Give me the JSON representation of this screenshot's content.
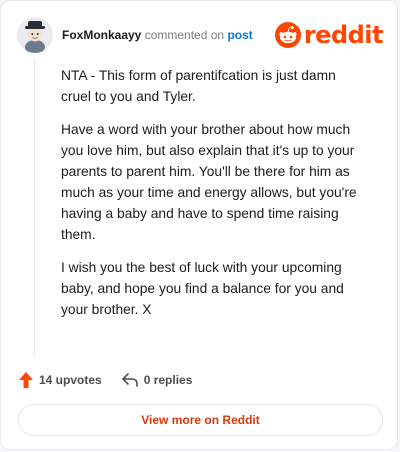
{
  "header": {
    "username": "FoxMonkaayy",
    "action_text": "commented on",
    "target_link": "post",
    "logo_text": "reddit"
  },
  "comment": {
    "paragraphs": [
      "NTA - This form of parentifcation is just damn cruel to you and Tyler.",
      "Have a word with your brother about how much you love him, but also explain that it's up to your parents to parent him. You'll be there for him as much as your time and energy allows, but you're having a baby and have to spend time raising them.",
      "I wish you the best of luck with your upcoming baby, and hope you find a balance for you and your brother. X"
    ]
  },
  "actions": {
    "upvotes_label": "14 upvotes",
    "replies_label": "0 replies"
  },
  "footer": {
    "view_more_label": "View more on Reddit"
  },
  "colors": {
    "brand": "#ff4500",
    "link": "#0079d3",
    "upvote": "#ff4500"
  }
}
